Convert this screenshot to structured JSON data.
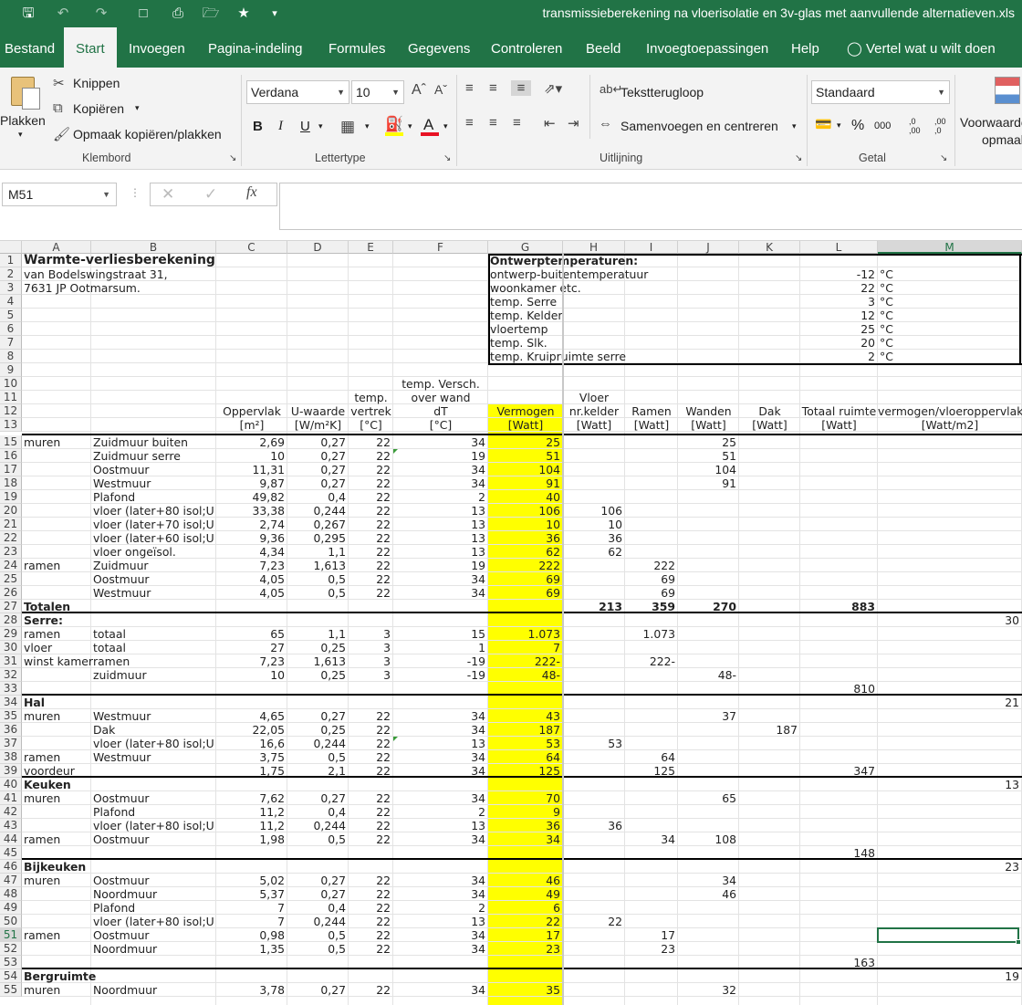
{
  "window": {
    "title": "transmissieberekening na vloerisolatie en 3v-glas met aanvullende alternatieven.xls"
  },
  "quick_access": {
    "save_icon": "save-icon",
    "undo_icon": "undo-icon",
    "redo_icon": "redo-icon"
  },
  "tabs": [
    "Bestand",
    "Start",
    "Invoegen",
    "Pagina-indeling",
    "Formules",
    "Gegevens",
    "Controleren",
    "Beeld",
    "Invoegtoepassingen",
    "Help"
  ],
  "active_tab": "Start",
  "tell_me": "Vertel wat u wilt doen",
  "ribbon": {
    "clipboard": {
      "paste": "Plakken",
      "cut": "Knippen",
      "copy": "Kopiëren",
      "format_painter": "Opmaak kopiëren/plakken",
      "label": "Klembord"
    },
    "font": {
      "name": "Verdana",
      "size": "10",
      "bold": "B",
      "italic": "I",
      "underline": "U",
      "color_letter": "A",
      "label": "Lettertype"
    },
    "alignment": {
      "wrap": "Tekstterugloop",
      "merge": "Samenvoegen en centreren",
      "label": "Uitlijning"
    },
    "number": {
      "format": "Standaard",
      "percent": "%",
      "thousands": "000",
      "inc_dec": ",0 ,00",
      "dec_dec": ",00 ,0",
      "label": "Getal"
    },
    "styles": {
      "conditional": "Voorwaardelijke",
      "opmaak": "opmaak"
    }
  },
  "formula_bar": {
    "name_box": "M51",
    "fx": "fx",
    "cancel": "✕",
    "enter": "✓",
    "value": ""
  },
  "columns": [
    "A",
    "B",
    "C",
    "D",
    "E",
    "F",
    "G",
    "H",
    "I",
    "J",
    "K",
    "L",
    "M"
  ],
  "selected_cell": {
    "col": "M",
    "row": "51"
  },
  "rows": [
    {
      "n": "1",
      "A": "Warmte-verliesberekening",
      "G": "Ontwerptemperaturen:"
    },
    {
      "n": "2",
      "A": "van Bodelswingstraat 31,",
      "G": "ontwerp-buitentemperatuur",
      "L": "-12",
      "M": "°C"
    },
    {
      "n": "3",
      "A": " 7631 JP Ootmarsum.",
      "G": "woonkamer etc.",
      "L": "22",
      "M": "°C"
    },
    {
      "n": "4",
      "G": "temp. Serre",
      "L": "3",
      "M": "°C"
    },
    {
      "n": "5",
      "G": "temp. Kelder",
      "L": "12",
      "M": "°C"
    },
    {
      "n": "6",
      "G": "vloertemp",
      "L": "25",
      "M": "°C"
    },
    {
      "n": "7",
      "G": "temp. Slk.",
      "L": "20",
      "M": "°C"
    },
    {
      "n": "8",
      "G": "temp. Kruipruimte serre",
      "L": "2",
      "M": "°C"
    },
    {
      "n": "9"
    },
    {
      "n": "10",
      "F": "temp. Versch."
    },
    {
      "n": "11",
      "E": "temp.",
      "F": "over wand",
      "H": "Vloer"
    },
    {
      "n": "12",
      "C": "Oppervlak",
      "D": "U-waarde",
      "E": "vertrek",
      "F": "dT",
      "G": "Vermogen",
      "H": "nr.kelder",
      "I": "Ramen",
      "J": "Wanden",
      "K": "Dak",
      "L": "Totaal ruimte",
      "M": "vermogen/vloeroppervlak"
    },
    {
      "n": "13",
      "C": "[m²]",
      "D": "[W/m²K]",
      "E": "[°C]",
      "F": "[°C]",
      "G": "[Watt]",
      "H": "[Watt]",
      "I": "[Watt]",
      "J": "[Watt]",
      "K": "[Watt]",
      "L": "[Watt]",
      "M": "[Watt/m2]"
    },
    {
      "n": "15",
      "A": "muren",
      "B": "Zuidmuur buiten",
      "C": "2,69",
      "D": "0,27",
      "E": "22",
      "F": "34",
      "G": "25",
      "J": "25"
    },
    {
      "n": "16",
      "B": "Zuidmuur serre",
      "C": "10",
      "D": "0,27",
      "E": "22",
      "F": "19",
      "G": "51",
      "J": "51"
    },
    {
      "n": "17",
      "B": "Oostmuur",
      "C": "11,31",
      "D": "0,27",
      "E": "22",
      "F": "34",
      "G": "104",
      "J": "104"
    },
    {
      "n": "18",
      "B": "Westmuur",
      "C": "9,87",
      "D": "0,27",
      "E": "22",
      "F": "34",
      "G": "91",
      "J": "91"
    },
    {
      "n": "19",
      "B": "Plafond",
      "C": "49,82",
      "D": "0,4",
      "E": "22",
      "F": "2",
      "G": "40"
    },
    {
      "n": "20",
      "B": "vloer (later+80 isol;U",
      "C": "33,38",
      "D": "0,244",
      "E": "22",
      "F": "13",
      "G": "106",
      "H": "106"
    },
    {
      "n": "21",
      "B": "vloer (later+70 isol;U",
      "C": "2,74",
      "D": "0,267",
      "E": "22",
      "F": "13",
      "G": "10",
      "H": "10"
    },
    {
      "n": "22",
      "B": "vloer (later+60 isol;U",
      "C": "9,36",
      "D": "0,295",
      "E": "22",
      "F": "13",
      "G": "36",
      "H": "36"
    },
    {
      "n": "23",
      "B": "vloer ongeïsol.",
      "C": "4,34",
      "D": "1,1",
      "E": "22",
      "F": "13",
      "G": "62",
      "H": "62"
    },
    {
      "n": "24",
      "A": "ramen",
      "B": "Zuidmuur",
      "C": "7,23",
      "D": "1,613",
      "E": "22",
      "F": "19",
      "G": "222",
      "I": "222"
    },
    {
      "n": "25",
      "B": "Oostmuur",
      "C": "4,05",
      "D": "0,5",
      "E": "22",
      "F": "34",
      "G": "69",
      "I": "69"
    },
    {
      "n": "26",
      "B": "Westmuur",
      "C": "4,05",
      "D": "0,5",
      "E": "22",
      "F": "34",
      "G": "69",
      "I": "69"
    },
    {
      "n": "27",
      "A": "Totalen",
      "H": "213",
      "I": "359",
      "J": "270",
      "L": "883"
    },
    {
      "n": "28",
      "A": "Serre:",
      "M": "30"
    },
    {
      "n": "29",
      "A": "ramen",
      "B": "totaal",
      "C": "65",
      "D": "1,1",
      "E": "3",
      "F": "15",
      "G": "1.073",
      "I": "1.073"
    },
    {
      "n": "30",
      "A": "vloer",
      "B": "totaal",
      "C": "27",
      "D": "0,25",
      "E": "3",
      "F": "1",
      "G": "7"
    },
    {
      "n": "31",
      "A": "winst kamer",
      "B": "ramen",
      "C": "7,23",
      "D": "1,613",
      "E": "3",
      "F": "-19",
      "G": "222-",
      "I": "222-"
    },
    {
      "n": "32",
      "B": "zuidmuur",
      "C": "10",
      "D": "0,25",
      "E": "3",
      "F": "-19",
      "G": "48-",
      "J": "48-"
    },
    {
      "n": "33",
      "L": "810"
    },
    {
      "n": "34",
      "A": "Hal",
      "M": "21"
    },
    {
      "n": "35",
      "A": "muren",
      "B": "Westmuur",
      "C": "4,65",
      "D": "0,27",
      "E": "22",
      "F": "34",
      "G": "43",
      "J": "37"
    },
    {
      "n": "36",
      "B": "Dak",
      "C": "22,05",
      "D": "0,25",
      "E": "22",
      "F": "34",
      "G": "187",
      "K": "187"
    },
    {
      "n": "37",
      "B": "vloer (later+80 isol;U",
      "C": "16,6",
      "D": "0,244",
      "E": "22",
      "F": "13",
      "G": "53",
      "H": "53"
    },
    {
      "n": "38",
      "A": "ramen",
      "B": "Westmuur",
      "C": "3,75",
      "D": "0,5",
      "E": "22",
      "F": "34",
      "G": "64",
      "I": "64"
    },
    {
      "n": "39",
      "A": "voordeur",
      "C": "1,75",
      "D": "2,1",
      "E": "22",
      "F": "34",
      "G": "125",
      "I": "125",
      "L": "347"
    },
    {
      "n": "40",
      "A": "Keuken",
      "M": "13"
    },
    {
      "n": "41",
      "A": "muren",
      "B": "Oostmuur",
      "C": "7,62",
      "D": "0,27",
      "E": "22",
      "F": "34",
      "G": "70",
      "J": "65"
    },
    {
      "n": "42",
      "B": "Plafond",
      "C": "11,2",
      "D": "0,4",
      "E": "22",
      "F": "2",
      "G": "9"
    },
    {
      "n": "43",
      "B": "vloer (later+80 isol;U",
      "C": "11,2",
      "D": "0,244",
      "E": "22",
      "F": "13",
      "G": "36",
      "H": "36"
    },
    {
      "n": "44",
      "A": "ramen",
      "B": "Oostmuur",
      "C": "1,98",
      "D": "0,5",
      "E": "22",
      "F": "34",
      "G": "34",
      "I": "34",
      "J": "108"
    },
    {
      "n": "45",
      "L": "148"
    },
    {
      "n": "46",
      "A": "Bijkeuken",
      "M": "23"
    },
    {
      "n": "47",
      "A": "muren",
      "B": "Oostmuur",
      "C": "5,02",
      "D": "0,27",
      "E": "22",
      "F": "34",
      "G": "46",
      "J": "34"
    },
    {
      "n": "48",
      "B": "Noordmuur",
      "C": "5,37",
      "D": "0,27",
      "E": "22",
      "F": "34",
      "G": "49",
      "J": "46"
    },
    {
      "n": "49",
      "B": "Plafond",
      "C": "7",
      "D": "0,4",
      "E": "22",
      "F": "2",
      "G": "6"
    },
    {
      "n": "50",
      "B": "vloer (later+80 isol;U",
      "C": "7",
      "D": "0,244",
      "E": "22",
      "F": "13",
      "G": "22",
      "H": "22"
    },
    {
      "n": "51",
      "A": "ramen",
      "B": "Oostmuur",
      "C": "0,98",
      "D": "0,5",
      "E": "22",
      "F": "34",
      "G": "17",
      "I": "17"
    },
    {
      "n": "52",
      "B": "Noordmuur",
      "C": "1,35",
      "D": "0,5",
      "E": "22",
      "F": "34",
      "G": "23",
      "I": "23"
    },
    {
      "n": "53",
      "L": "163"
    },
    {
      "n": "54",
      "A": "Bergruimte",
      "M": "19"
    },
    {
      "n": "55",
      "A": "muren",
      "B": "Noordmuur",
      "C": "3,78",
      "D": "0,27",
      "E": "22",
      "F": "34",
      "G": "35",
      "J": "32"
    }
  ],
  "colors": {
    "excel_green": "#217346",
    "highlight": "#ffff00"
  }
}
